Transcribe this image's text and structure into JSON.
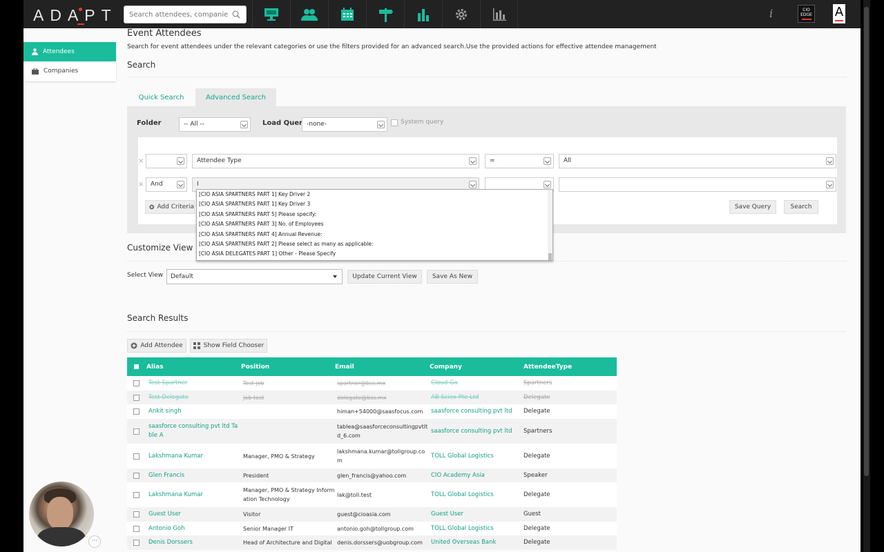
{
  "header": {
    "logo": "ADAPT",
    "search_placeholder": "Search attendees, companies...",
    "info_label": "i",
    "cio_badge": "CIO EDGE",
    "user_initial": "A"
  },
  "nav_icons": [
    "presentation-icon",
    "people-icon",
    "calendar-icon",
    "signpost-icon",
    "bar-chart-icon",
    "gear-icon",
    "column-chart-icon"
  ],
  "sidebar": {
    "items": [
      {
        "label": "Attendees",
        "icon": "person-icon",
        "active": true
      },
      {
        "label": "Companies",
        "icon": "briefcase-icon",
        "active": false
      }
    ]
  },
  "page": {
    "title": "Event Attendees",
    "description": "Search for event attendees under the relevant categories or use the filters provided for an advanced search.Use the provided actions for effective attendee management"
  },
  "search": {
    "heading": "Search",
    "tabs": [
      "Quick Search",
      "Advanced Search"
    ],
    "active_tab": "Advanced Search",
    "folder_label": "Folder",
    "folder_value": "-- All --",
    "load_query_label": "Load Query",
    "load_query_value": "-none-",
    "system_query_label": "System query",
    "criteria": [
      {
        "remove": "×",
        "conj": "",
        "field": "Attendee Type",
        "op": "=",
        "value": "All"
      },
      {
        "remove": "×",
        "conj": "And",
        "field": "I",
        "op": "",
        "value": ""
      }
    ],
    "add_criteria": "Add Criteria",
    "save_query": "Save Query",
    "search_button": "Search",
    "dropdown_options": [
      "[CIO ASIA SPARTNERS PART 1] Key Driver 2",
      "[CIO ASIA SPARTNERS PART 1] Key Driver 3",
      "[CIO ASIA SPARTNERS PART 5] Please specify:",
      "[CIO ASIA SPARTNERS PART 3] No. of Employees",
      "[CIO ASIA SPARTNERS PART 4] Annual Revenue:",
      "[CIO ASIA SPARTNERS PART 2] Please select as many as applicable:",
      "[CIO ASIA DELEGATES PART 1] Other  - Please Specify"
    ]
  },
  "customize": {
    "heading": "Customize View",
    "select_view_label": "Select View",
    "view_value": "Default",
    "update_button": "Update Current View",
    "save_new_button": "Save As New"
  },
  "results": {
    "heading": "Search Results",
    "add_attendee": "Add Attendee",
    "field_chooser": "Show Field Chooser",
    "columns": [
      "Alias",
      "Position",
      "Email",
      "Company",
      "AttendeeType"
    ],
    "rows": [
      {
        "alias": "Test Spartner",
        "position": "Test job",
        "email": "spartner@bss.mx",
        "company": "Cloud Go",
        "type": "Spartners",
        "struck": true
      },
      {
        "alias": "Test Delegate",
        "position": "Job test",
        "email": "delegate@bss.mx",
        "company": "AB Sciex Pte Ltd",
        "type": "Delegate",
        "struck": true
      },
      {
        "alias": "Ankit singh",
        "position": "",
        "email": "himan+54000@saasfocus.com",
        "company": "saasforce consulting pvt ltd",
        "type": "Delegate",
        "struck": false
      },
      {
        "alias": "saasforce consulting pvt ltd Ta\nble A",
        "position": "",
        "email": "tablea@saasforceconsultingpvtlt\nd_6.com",
        "company": "saasforce consulting pvt ltd",
        "type": "Spartners",
        "struck": false
      },
      {
        "alias": "Lakshmana Kumar",
        "position": "Manager, PMO & Strategy",
        "email": "lakshmana.kumar@tollgroup.co\nm",
        "company": "TOLL Global Logistics",
        "type": "Delegate",
        "struck": false
      },
      {
        "alias": "Glen Francis",
        "position": "President",
        "email": "glen_francis@yahoo.com",
        "company": "CIO Academy Asia",
        "type": "Speaker",
        "struck": false
      },
      {
        "alias": "Lakshmana Kumar",
        "position": "Manager, PMO & Strategy Inform\nation Technology",
        "email": "lak@toll.test",
        "company": "TOLL Global Logistics",
        "type": "Delegate",
        "struck": false
      },
      {
        "alias": "Guest User",
        "position": "Visitor",
        "email": "guest@cioasia.com",
        "company": "Guest User",
        "type": "Guest",
        "struck": false
      },
      {
        "alias": "Antonio Goh",
        "position": "Senior Manager IT",
        "email": "antonio.goh@tollgroup.com",
        "company": "TOLL Global Logistics",
        "type": "Delegate",
        "struck": false
      },
      {
        "alias": "Denis Dorssers",
        "position": "Head of Architecture and Digital",
        "email": "denis.dorssers@uobgroup.com",
        "company": "United Overseas Bank",
        "type": "Delegate",
        "struck": false
      }
    ]
  },
  "webcam": {
    "more": "···"
  },
  "colors": {
    "accent": "#1abc9c",
    "topbar": "#222222",
    "brand_red": "#e53935"
  }
}
